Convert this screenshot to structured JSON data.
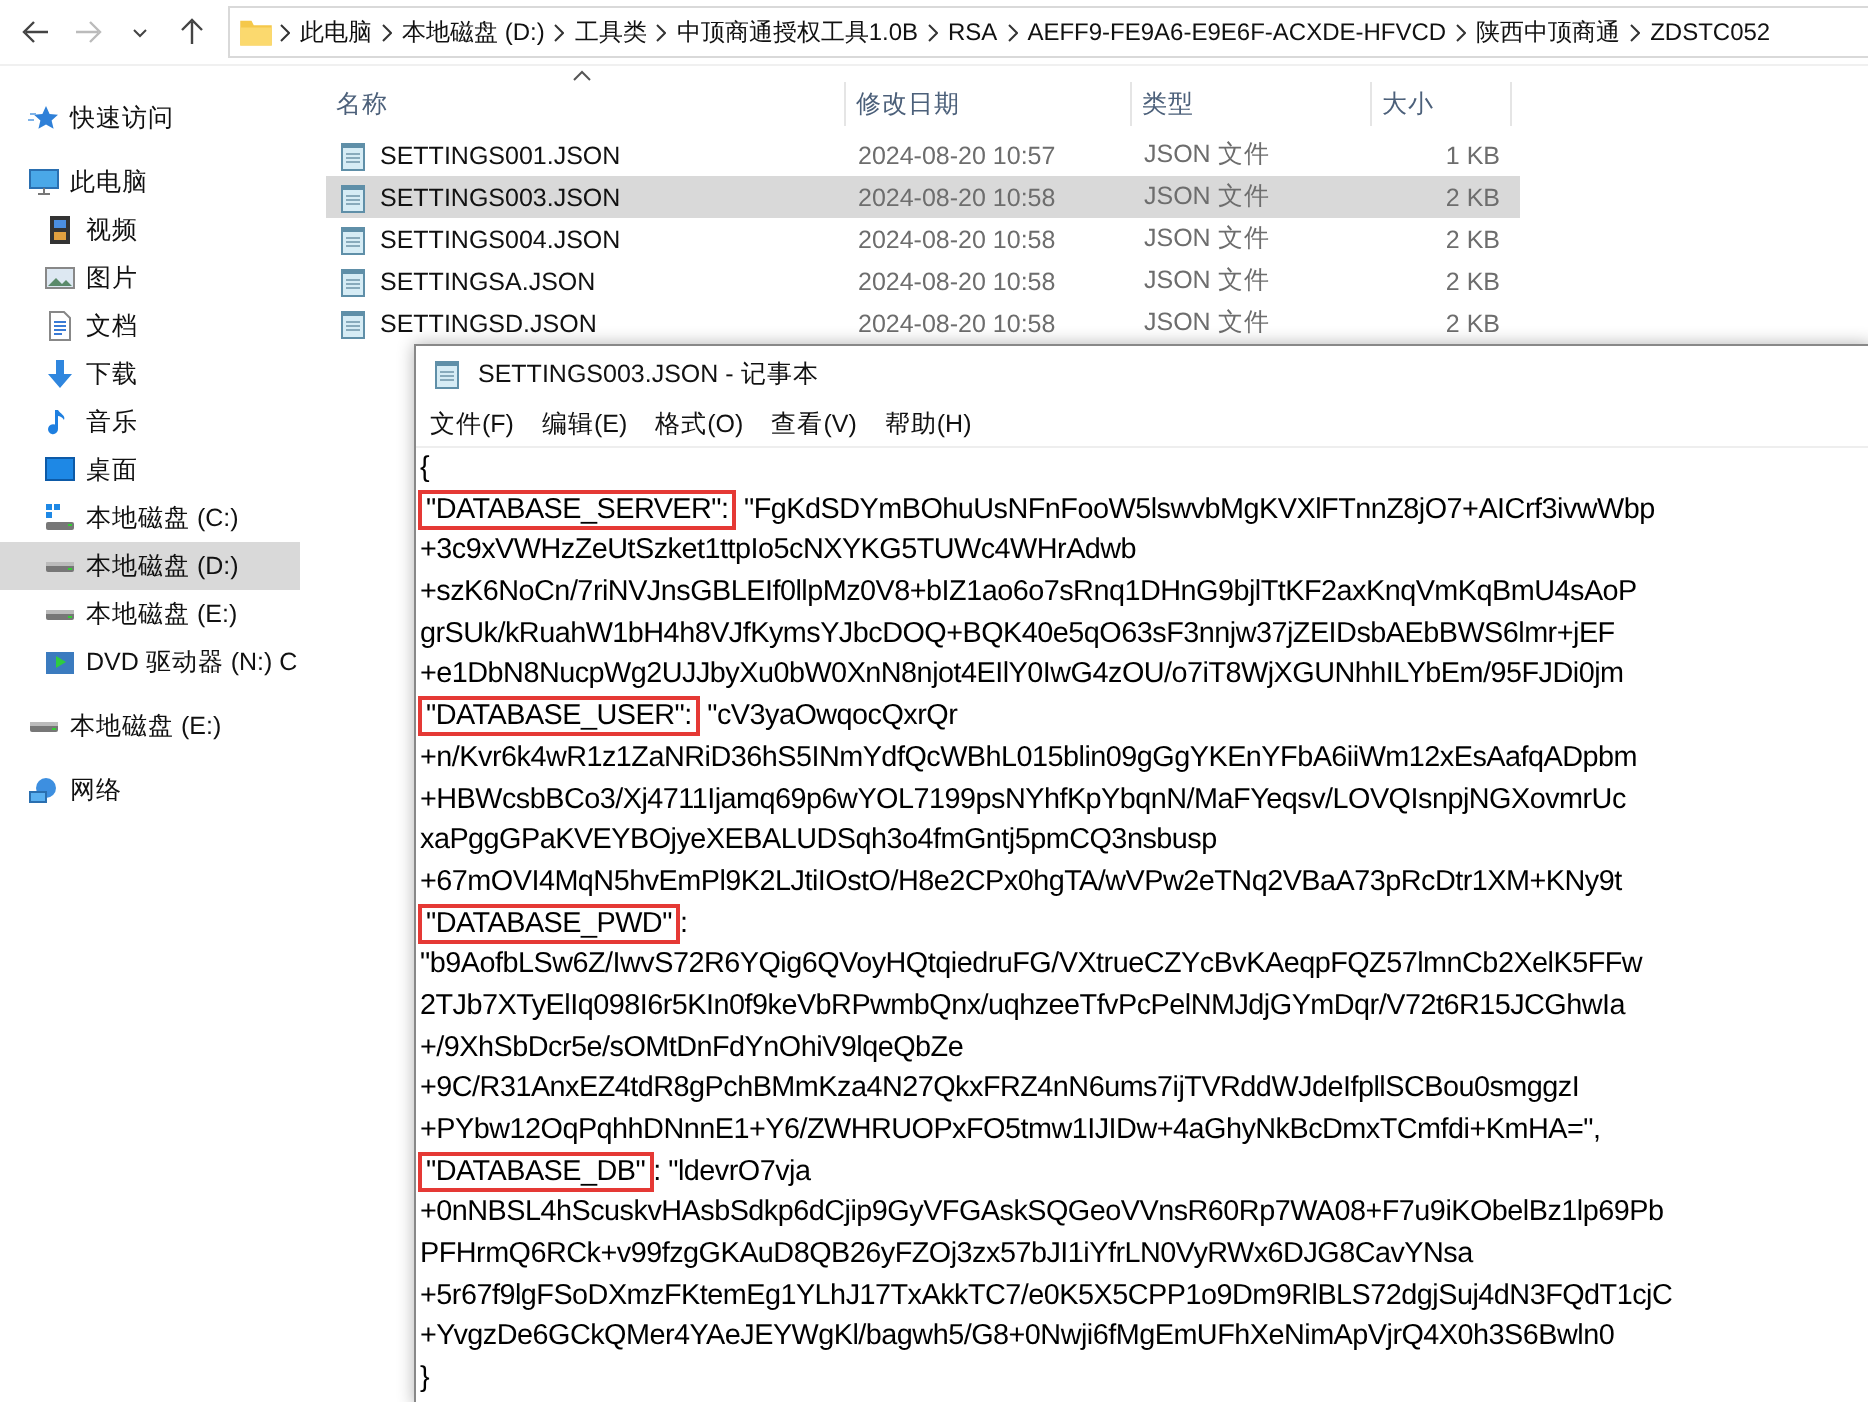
{
  "explorer": {
    "breadcrumb": [
      "此电脑",
      "本地磁盘 (D:)",
      "工具类",
      "中顶商通授权工具1.0B",
      "RSA",
      "AEFF9-FE9A6-E9E6F-ACXDE-HFVCD",
      "陕西中顶商通",
      "ZDSTC052"
    ],
    "sidebar": [
      {
        "label": "快速访问",
        "kind": "star",
        "selected": false
      },
      {
        "label": "此电脑",
        "kind": "pc",
        "selected": false,
        "children": [
          {
            "label": "视频",
            "kind": "video",
            "selected": false
          },
          {
            "label": "图片",
            "kind": "pictures",
            "selected": false
          },
          {
            "label": "文档",
            "kind": "docs",
            "selected": false
          },
          {
            "label": "下载",
            "kind": "download",
            "selected": false
          },
          {
            "label": "音乐",
            "kind": "music",
            "selected": false
          },
          {
            "label": "桌面",
            "kind": "desktop",
            "selected": false
          },
          {
            "label": "本地磁盘 (C:)",
            "kind": "drive-win",
            "selected": false
          },
          {
            "label": "本地磁盘 (D:)",
            "kind": "drive",
            "selected": true
          },
          {
            "label": "本地磁盘 (E:)",
            "kind": "drive",
            "selected": false
          },
          {
            "label": "DVD 驱动器 (N:) C",
            "kind": "dvd",
            "selected": false
          }
        ]
      },
      {
        "label": "本地磁盘 (E:)",
        "kind": "drive",
        "selected": false
      },
      {
        "label": "网络",
        "kind": "network",
        "selected": false
      }
    ],
    "columns": [
      "名称",
      "修改日期",
      "类型",
      "大小"
    ],
    "files": [
      {
        "name": "SETTINGS001.JSON",
        "date": "2024-08-20 10:57",
        "type": "JSON 文件",
        "size": "1 KB",
        "selected": false
      },
      {
        "name": "SETTINGS003.JSON",
        "date": "2024-08-20 10:58",
        "type": "JSON 文件",
        "size": "2 KB",
        "selected": true
      },
      {
        "name": "SETTINGS004.JSON",
        "date": "2024-08-20 10:58",
        "type": "JSON 文件",
        "size": "2 KB",
        "selected": false
      },
      {
        "name": "SETTINGSA.JSON",
        "date": "2024-08-20 10:58",
        "type": "JSON 文件",
        "size": "2 KB",
        "selected": false
      },
      {
        "name": "SETTINGSD.JSON",
        "date": "2024-08-20 10:58",
        "type": "JSON 文件",
        "size": "2 KB",
        "selected": false
      }
    ]
  },
  "notepad": {
    "title": "SETTINGS003.JSON - 记事本",
    "menu": [
      "文件(F)",
      "编辑(E)",
      "格式(O)",
      "查看(V)",
      "帮助(H)"
    ],
    "lines": [
      {
        "text": "{"
      },
      {
        "key": "\"DATABASE_SERVER\":",
        "text": " \"FgKdSDYmBOhuUsNFnFooW5lswvbMgKVXlFTnnZ8jO7+AICrf3ivwWbp"
      },
      {
        "text": "+3c9xVWHzZeUtSzket1ttpIo5cNXYKG5TUWc4WHrAdwb"
      },
      {
        "text": "+szK6NoCn/7riNVJnsGBLEIf0llpMz0V8+bIZ1ao6o7sRnq1DHnG9bjlTtKF2axKnqVmKqBmU4sAoP"
      },
      {
        "text": "grSUk/kRuahW1bH4h8VJfKymsYJbcDOQ+BQK40e5qO63sF3nnjw37jZEIDsbAEbBWS6lmr+jEF"
      },
      {
        "text": "+e1DbN8NucpWg2UJJbyXu0bW0XnN8njot4EIlY0IwG4zOU/o7iT8WjXGUNhhILYbEm/95FJDi0jm"
      },
      {
        "key": "\"DATABASE_USER\":",
        "text": " \"cV3yaOwqocQxrQr"
      },
      {
        "text": "+n/Kvr6k4wR1z1ZaNRiD36hS5INmYdfQcWBhL015blin09gGgYKEnYFbA6iiWm12xEsAafqADpbm"
      },
      {
        "text": "+HBWcsbBCo3/Xj4711Ijamq69p6wYOL7199psNYhfKpYbqnN/MaFYeqsv/LOVQIsnpjNGXovmrUc"
      },
      {
        "text": "xaPggGPaKVEYBOjyeXEBALUDSqh3o4fmGntj5pmCQ3nsbusp"
      },
      {
        "text": "+67mOVI4MqN5hvEmPl9K2LJtiIOstO/H8e2CPx0hgTA/wVPw2eTNq2VBaA73pRcDtr1XM+KNy9t"
      },
      {
        "key": "\"DATABASE_PWD\"",
        "text": ":"
      },
      {
        "text": "\"b9AofbLSw6Z/IwvS72R6YQig6QVoyHQtqiedruFG/VXtrueCZYcBvKAeqpFQZ57lmnCb2XelK5FFw"
      },
      {
        "text": "2TJb7XTyElIq098I6r5KIn0f9keVbRPwmbQnx/uqhzeeTfvPcPelNMJdjGYmDqr/V72t6R15JCGhwIa"
      },
      {
        "text": "+/9XhSbDcr5e/sOMtDnFdYnOhiV9lqeQbZe"
      },
      {
        "text": "+9C/R31AnxEZ4tdR8gPchBMmKza4N27QkxFRZ4nN6ums7ijTVRddWJdeIfpllSCBou0smggzI"
      },
      {
        "text": "+PYbw12OqPqhhDNnnE1+Y6/ZWHRUOPxFO5tmw1IJIDw+4aGhyNkBcDmxTCmfdi+KmHA=\","
      },
      {
        "key": "\"DATABASE_DB\"",
        "text": ": \"ldevrO7vja"
      },
      {
        "text": "+0nNBSL4hScuskvHAsbSdkp6dCjip9GyVFGAskSQGeoVVnsR60Rp7WA08+F7u9iKObelBz1lp69Pb"
      },
      {
        "text": "PFHrmQ6RCk+v99fzgGKAuD8QB26yFZOj3zx57bJI1iYfrLN0VyRWx6DJG8CavYNsa"
      },
      {
        "text": "+5r67f9lgFSoDXmzFKtemEg1YLhJ17TxAkkTC7/e0K5X5CPP1o9Dm9RlBLS72dgjSuj4dN3FQdT1cjC"
      },
      {
        "text": "+YvgzDe6GCkQMer4YAeJEYWgKl/bagwh5/G8+0Nwji6fMgEmUFhXeNimApVjrQ4X0h3S6Bwln0"
      },
      {
        "text": "}"
      }
    ]
  }
}
